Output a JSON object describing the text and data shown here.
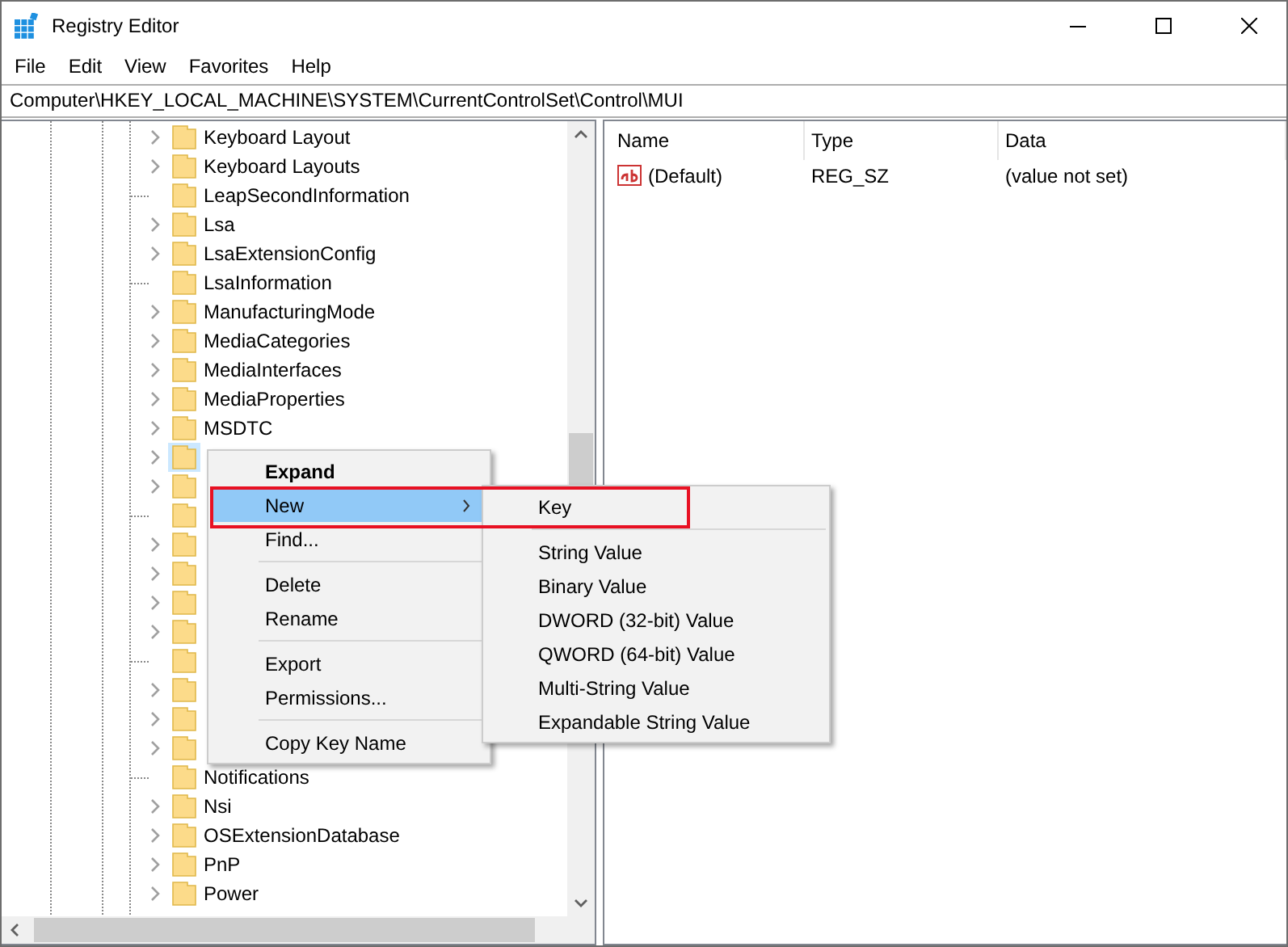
{
  "window": {
    "title": "Registry Editor"
  },
  "menu_bar": [
    "File",
    "Edit",
    "View",
    "Favorites",
    "Help"
  ],
  "address": "Computer\\HKEY_LOCAL_MACHINE\\SYSTEM\\CurrentControlSet\\Control\\MUI",
  "tree": [
    {
      "name": "Keyboard Layout",
      "expandable": true,
      "selected": false
    },
    {
      "name": "Keyboard Layouts",
      "expandable": true,
      "selected": false
    },
    {
      "name": "LeapSecondInformation",
      "expandable": false,
      "selected": false
    },
    {
      "name": "Lsa",
      "expandable": true,
      "selected": false
    },
    {
      "name": "LsaExtensionConfig",
      "expandable": true,
      "selected": false
    },
    {
      "name": "LsaInformation",
      "expandable": false,
      "selected": false
    },
    {
      "name": "ManufacturingMode",
      "expandable": true,
      "selected": false
    },
    {
      "name": "MediaCategories",
      "expandable": true,
      "selected": false
    },
    {
      "name": "MediaInterfaces",
      "expandable": true,
      "selected": false
    },
    {
      "name": "MediaProperties",
      "expandable": true,
      "selected": false
    },
    {
      "name": "MSDTC",
      "expandable": true,
      "selected": false
    },
    {
      "expandable": true,
      "selected": true
    },
    {
      "expandable": true,
      "selected": false
    },
    {
      "expandable": false,
      "selected": false
    },
    {
      "expandable": true,
      "selected": false
    },
    {
      "expandable": true,
      "selected": false
    },
    {
      "expandable": true,
      "selected": false
    },
    {
      "expandable": true,
      "selected": false
    },
    {
      "expandable": false,
      "selected": false
    },
    {
      "expandable": true,
      "selected": false
    },
    {
      "expandable": true,
      "selected": false
    },
    {
      "expandable": true,
      "selected": false
    },
    {
      "name": "Notifications",
      "expandable": false,
      "selected": false
    },
    {
      "name": "Nsi",
      "expandable": true,
      "selected": false
    },
    {
      "name": "OSExtensionDatabase",
      "expandable": true,
      "selected": false
    },
    {
      "name": "PnP",
      "expandable": true,
      "selected": false
    },
    {
      "name": "Power",
      "expandable": true,
      "selected": false
    }
  ],
  "values_table": {
    "columns": [
      "Name",
      "Type",
      "Data"
    ],
    "rows": [
      {
        "name": "(Default)",
        "type": "REG_SZ",
        "data": "(value not set)"
      }
    ]
  },
  "context_menu": {
    "items": [
      {
        "kind": "item",
        "label": "Expand",
        "default": true,
        "selected": false
      },
      {
        "kind": "item",
        "label": "New",
        "default": false,
        "selected": true,
        "submenu": true
      },
      {
        "kind": "item",
        "label": "Find...",
        "default": false,
        "selected": false
      },
      {
        "kind": "separator"
      },
      {
        "kind": "item",
        "label": "Delete",
        "default": false,
        "selected": false
      },
      {
        "kind": "item",
        "label": "Rename",
        "default": false,
        "selected": false
      },
      {
        "kind": "separator"
      },
      {
        "kind": "item",
        "label": "Export",
        "default": false,
        "selected": false
      },
      {
        "kind": "item",
        "label": "Permissions...",
        "default": false,
        "selected": false
      },
      {
        "kind": "separator"
      },
      {
        "kind": "item",
        "label": "Copy Key Name",
        "default": false,
        "selected": false
      }
    ]
  },
  "submenu": {
    "items": [
      {
        "kind": "item",
        "label": "Key"
      },
      {
        "kind": "separator"
      },
      {
        "kind": "item",
        "label": "String Value"
      },
      {
        "kind": "item",
        "label": "Binary Value"
      },
      {
        "kind": "item",
        "label": "DWORD (32-bit) Value"
      },
      {
        "kind": "item",
        "label": "QWORD (64-bit) Value"
      },
      {
        "kind": "item",
        "label": "Multi-String Value"
      },
      {
        "kind": "item",
        "label": "Expandable String Value"
      }
    ]
  }
}
